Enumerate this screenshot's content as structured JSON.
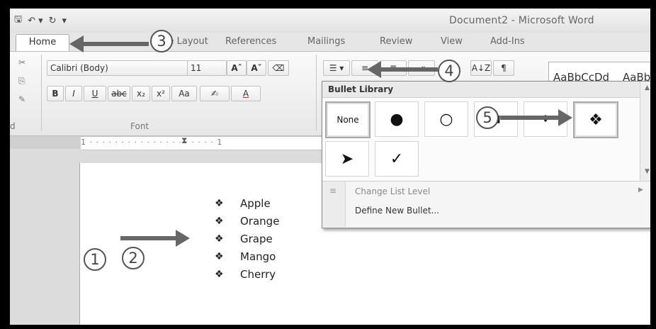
{
  "window": {
    "title": "Document2 - Microsoft Word"
  },
  "tabs": [
    "Home",
    "Page Layout",
    "References",
    "Mailings",
    "Review",
    "View",
    "Add-Ins"
  ],
  "ribbon": {
    "font_name": "Calibri (Body)",
    "font_size": "11",
    "grow_font": "Aˆ",
    "shrink_font": "Aˇ",
    "bold": "B",
    "italic": "I",
    "underline": "U",
    "strike": "abc",
    "subscript": "x₂",
    "superscript": "x²",
    "change_case": "Aa",
    "font_color": "A",
    "font_group": "Font",
    "clipboard_group": "d",
    "sort": "A↓Z",
    "show_marks": "¶",
    "style_preview_1": "AaBbCcDd",
    "style_preview_2": "AaBb"
  },
  "ruler_text": "1 · · · · · · · · · · · · · · · · · · · · 1",
  "document": {
    "bullet_symbol": "❖",
    "items": [
      "Apple",
      "Orange",
      "Grape",
      "Mango",
      "Cherry"
    ]
  },
  "bullet_library": {
    "title": "Bullet Library",
    "none_label": "None",
    "row1": [
      "●",
      "○",
      "",
      "",
      "❖"
    ],
    "row2": [
      "➤",
      "✓"
    ],
    "menu": {
      "change_level": "Change List Level",
      "define_new": "Define New Bullet..."
    }
  },
  "callouts": [
    "1",
    "2",
    "3",
    "4",
    "5"
  ]
}
